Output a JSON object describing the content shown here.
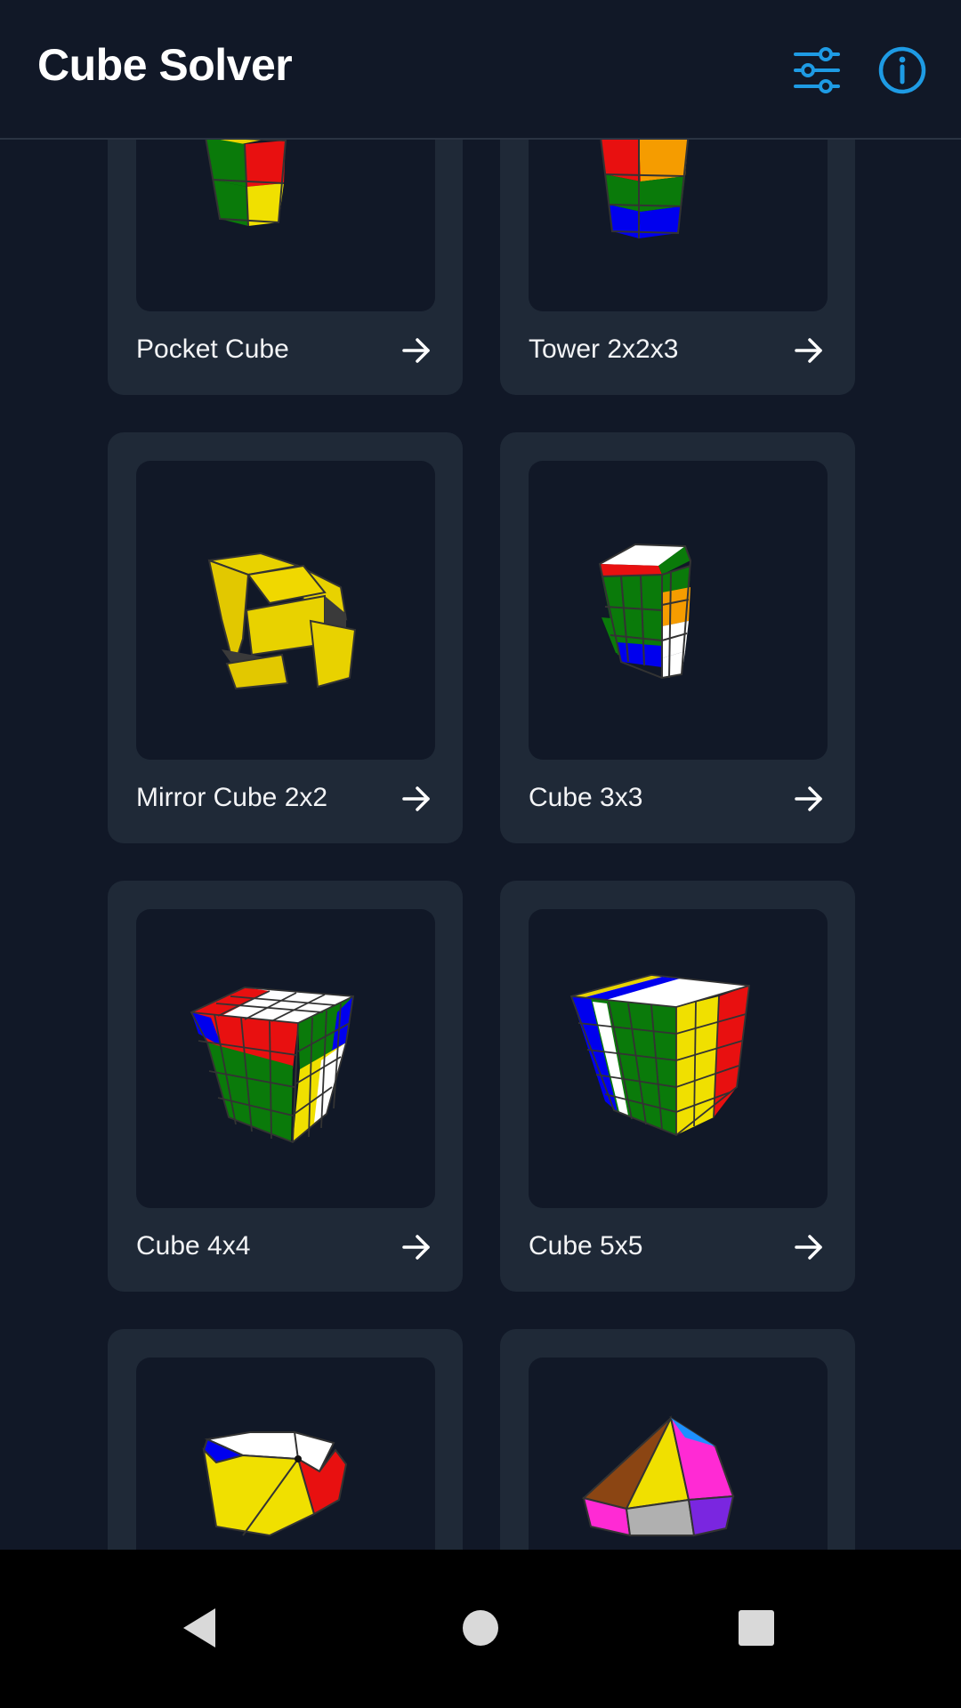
{
  "app": {
    "title": "Cube Solver"
  },
  "toolbar": {
    "settings_icon": "sliders-icon",
    "info_icon": "info-icon"
  },
  "colors": {
    "accent": "#1e9be4",
    "background": "#111827",
    "card": "#1f2937"
  },
  "puzzles": [
    {
      "label": "Pocket Cube"
    },
    {
      "label": "Tower 2x2x3"
    },
    {
      "label": "Mirror Cube 2x2"
    },
    {
      "label": "Cube 3x3"
    },
    {
      "label": "Cube 4x4"
    },
    {
      "label": "Cube 5x5"
    },
    {
      "label": ""
    },
    {
      "label": ""
    }
  ],
  "navigation": {
    "back": "back-icon",
    "home": "home-icon",
    "recents": "recents-icon"
  }
}
